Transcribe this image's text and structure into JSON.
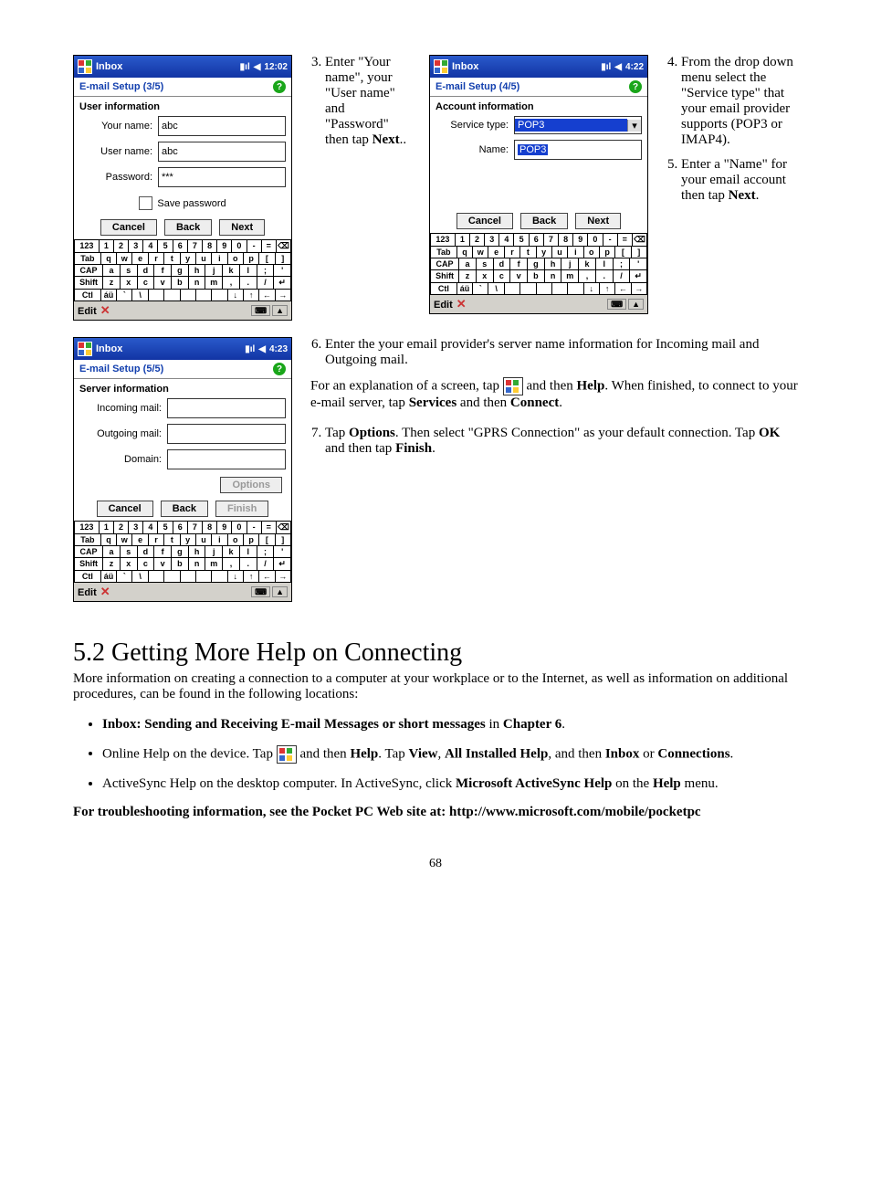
{
  "page_number": "68",
  "row1": {
    "shot1": {
      "title": "Inbox",
      "time": "12:02",
      "setup": "E-mail Setup (3/5)",
      "section": "User information",
      "your_name_l": "Your name:",
      "your_name_v": "abc",
      "user_name_l": "User name:",
      "user_name_v": "abc",
      "password_l": "Password:",
      "password_v": "***",
      "save_pw": "Save password",
      "cancel": "Cancel",
      "back": "Back",
      "next": "Next",
      "edit": "Edit"
    },
    "step3": "Enter \"Your name\", your \"User name\" and \"Password\" then tap ",
    "step3next": "Next",
    "step3after": "..",
    "shot2": {
      "title": "Inbox",
      "time": "4:22",
      "setup": "E-mail Setup (4/5)",
      "section": "Account information",
      "svc_type_l": "Service type:",
      "svc_type_v": "POP3",
      "name_l": "Name:",
      "name_v": "POP3",
      "cancel": "Cancel",
      "back": "Back",
      "next": "Next",
      "edit": "Edit"
    },
    "step4": "From the drop down menu select the \"Service type\" that your email provider supports (POP3 or IMAP4).",
    "step5a": "Enter a \"Name\" for your email account then tap ",
    "step5next": "Next",
    "step5after": "."
  },
  "row2": {
    "shot3": {
      "title": "Inbox",
      "time": "4:23",
      "setup": "E-mail Setup (5/5)",
      "section": "Server information",
      "inc_l": "Incoming mail:",
      "out_l": "Outgoing mail:",
      "dom_l": "Domain:",
      "options": "Options",
      "cancel": "Cancel",
      "back": "Back",
      "finish": "Finish",
      "edit": "Edit"
    },
    "step6": "Enter the your email provider's server name information for Incoming mail and Outgoing mail.",
    "explain1": "For an explanation of a screen, tap ",
    "explain2": " and then ",
    "explain_help": "Help",
    "explain3": ". When finished, to connect to your e-mail server, tap ",
    "explain_services": "Services",
    "explain_andthen": " and then ",
    "explain_connect": "Connect",
    "explain_dot": ".",
    "step7a": "Tap ",
    "step7_options": "Options",
    "step7b": ".  Then select \"GPRS Connection\" as your default connection.  Tap ",
    "step7_ok": "OK",
    "step7c": " and then tap ",
    "step7_finish": "Finish",
    "step7d": "."
  },
  "section52": {
    "heading": "5.2 Getting More Help on Connecting",
    "intro": "More information on creating a connection to a computer at your workplace or to the Internet, as well as information on additional procedures, can be found in the following locations:",
    "bullet1a": "Inbox: Sending and Receiving E-mail Messages or short messages",
    "bullet1b": " in ",
    "bullet1c": "Chapter 6",
    "bullet1d": ".",
    "bullet2a": "Online Help on the device. Tap ",
    "bullet2b": " and then ",
    "bullet2_help": "Help",
    "bullet2c": ". Tap ",
    "bullet2_view": "View",
    "bullet2d": ", ",
    "bullet2_allhelp": "All Installed Help",
    "bullet2e": ", and then ",
    "bullet2_inbox": "Inbox",
    "bullet2f": " or ",
    "bullet2_conn": "Connections",
    "bullet2g": ".",
    "bullet3a": "ActiveSync Help on the desktop computer. In ActiveSync, click ",
    "bullet3b": "Microsoft ActiveSync Help",
    "bullet3c": " on the ",
    "bullet3d": "Help",
    "bullet3e": " menu.",
    "trouble": "For troubleshooting information, see the Pocket PC Web site at: http://www.microsoft.com/mobile/pocketpc"
  },
  "kbd": {
    "r1": [
      "123",
      "1",
      "2",
      "3",
      "4",
      "5",
      "6",
      "7",
      "8",
      "9",
      "0",
      "-",
      "=",
      "⌫"
    ],
    "r2": [
      "Tab",
      "q",
      "w",
      "e",
      "r",
      "t",
      "y",
      "u",
      "i",
      "o",
      "p",
      "[",
      "]"
    ],
    "r3": [
      "CAP",
      "a",
      "s",
      "d",
      "f",
      "g",
      "h",
      "j",
      "k",
      "l",
      ";",
      "'"
    ],
    "r4": [
      "Shift",
      "z",
      "x",
      "c",
      "v",
      "b",
      "n",
      "m",
      ",",
      ".",
      "/",
      "↵"
    ],
    "r5": [
      "Ctl",
      "áü",
      "`",
      "\\",
      "",
      "",
      "",
      "",
      "",
      "↓",
      "↑",
      "←",
      "→"
    ]
  }
}
